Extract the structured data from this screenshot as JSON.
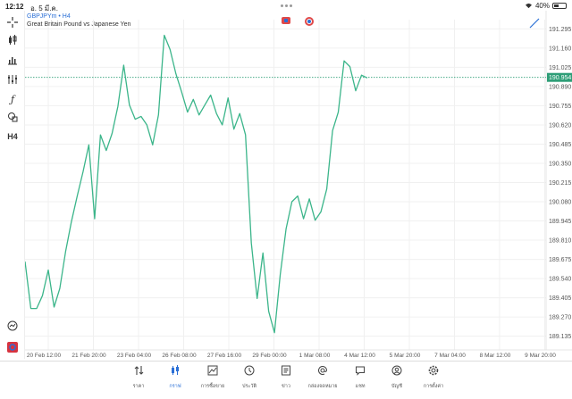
{
  "status": {
    "time": "12:12",
    "date": "อ. 5 มี.ค.",
    "battery": "40%",
    "battery_level": 0.4
  },
  "symbol": {
    "name": "GBPJPYm • H4",
    "description": "Great Britain Pound vs Japanese Yen"
  },
  "toolbar": {
    "timeframe": "H4",
    "icons": [
      "crosshair-icon",
      "candlestick-icon",
      "bar-chart-icon",
      "sliders-icon",
      "function-icon",
      "shapes-icon",
      "timeframe-label",
      "zoom-icon",
      "app-logo-icon"
    ]
  },
  "colors": {
    "line": "#3bb58a",
    "price_tag": "#2e9e77",
    "accent": "#2a6fd6",
    "grid": "#f0f0f0"
  },
  "chart_data": {
    "type": "line",
    "title": "",
    "xlabel": "",
    "ylabel": "",
    "current_price": "190.954",
    "y_ticks": [
      "191.295",
      "191.160",
      "191.025",
      "190.890",
      "190.755",
      "190.620",
      "190.485",
      "190.350",
      "190.215",
      "190.080",
      "189.945",
      "189.810",
      "189.675",
      "189.540",
      "189.405",
      "189.270",
      "189.135"
    ],
    "x_ticks": [
      "20 Feb 12:00",
      "21 Feb 20:00",
      "23 Feb 04:00",
      "26 Feb 08:00",
      "27 Feb 16:00",
      "29 Feb 00:00",
      "1 Mar 08:00",
      "4 Mar 12:00",
      "5 Mar 20:00",
      "7 Mar 04:00",
      "8 Mar 12:00",
      "9 Mar 20:00"
    ],
    "ylim": [
      189.07,
      191.36
    ],
    "series": [
      {
        "values": [
          189.66,
          189.33,
          189.33,
          189.42,
          189.6,
          189.34,
          189.47,
          189.73,
          189.94,
          190.12,
          190.29,
          190.48,
          189.96,
          190.55,
          190.44,
          190.56,
          190.75,
          191.04,
          190.76,
          190.66,
          190.68,
          190.62,
          190.48,
          190.69,
          191.25,
          191.15,
          190.98,
          190.85,
          190.71,
          190.8,
          190.69,
          190.76,
          190.83,
          190.7,
          190.62,
          190.81,
          190.59,
          190.7,
          190.55,
          189.79,
          189.4,
          189.72,
          189.31,
          189.16,
          189.57,
          189.89,
          190.08,
          190.12,
          189.96,
          190.1,
          189.95,
          190.01,
          190.17,
          190.58,
          190.71,
          191.07,
          191.03,
          190.86,
          190.97,
          190.95
        ]
      }
    ]
  },
  "bottom_nav": [
    {
      "label": "ราคา",
      "icon": "arrows-updown-icon"
    },
    {
      "label": "กราฟ",
      "icon": "chart-candles-icon"
    },
    {
      "label": "การซื้อขาย",
      "icon": "trade-chart-icon"
    },
    {
      "label": "ประวัติ",
      "icon": "history-icon"
    },
    {
      "label": "ข่าว",
      "icon": "news-icon"
    },
    {
      "label": "กล่องจดหมาย",
      "icon": "mail-at-icon"
    },
    {
      "label": "แชท",
      "icon": "chat-icon"
    },
    {
      "label": "บัญชี",
      "icon": "account-icon"
    },
    {
      "label": "การตั้งค่า",
      "icon": "gear-icon"
    }
  ]
}
